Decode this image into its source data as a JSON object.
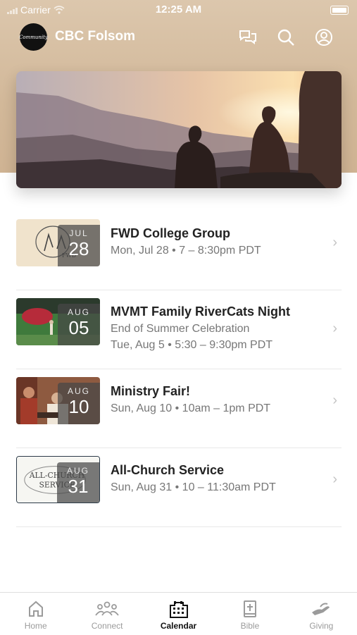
{
  "status_bar": {
    "carrier": "Carrier",
    "time": "12:25 AM"
  },
  "header": {
    "logo_text": "Community",
    "title": "CBC Folsom",
    "icons": [
      "chat-icon",
      "search-icon",
      "profile-icon"
    ]
  },
  "events": [
    {
      "month": "JUL",
      "day": "28",
      "title": "FWD College Group",
      "lines": [
        "Mon, Jul 28 • 7 – 8:30pm PDT"
      ],
      "thumb_text": "FWD"
    },
    {
      "month": "AUG",
      "day": "05",
      "title": "MVMT Family RiverCats Night",
      "lines": [
        "End of Summer Celebration",
        "Tue, Aug 5 • 5:30 – 9:30pm PDT"
      ],
      "thumb_text": ""
    },
    {
      "month": "AUG",
      "day": "10",
      "title": "Ministry Fair!",
      "lines": [
        "Sun, Aug 10 • 10am – 1pm PDT"
      ],
      "thumb_text": ""
    },
    {
      "month": "AUG",
      "day": "31",
      "title": "All-Church Service",
      "lines": [
        "Sun, Aug 31 • 10 – 11:30am PDT"
      ],
      "thumb_text": "ALL-CHURCH SERVICE"
    }
  ],
  "tabs": [
    {
      "label": "Home",
      "icon": "home-icon"
    },
    {
      "label": "Connect",
      "icon": "people-icon"
    },
    {
      "label": "Calendar",
      "icon": "calendar-icon",
      "active": true
    },
    {
      "label": "Bible",
      "icon": "bible-icon"
    },
    {
      "label": "Giving",
      "icon": "giving-icon"
    }
  ],
  "colors": {
    "header_bg": "#d2b899",
    "active_tab": "#111111",
    "inactive_tab": "#9b9b9b"
  }
}
